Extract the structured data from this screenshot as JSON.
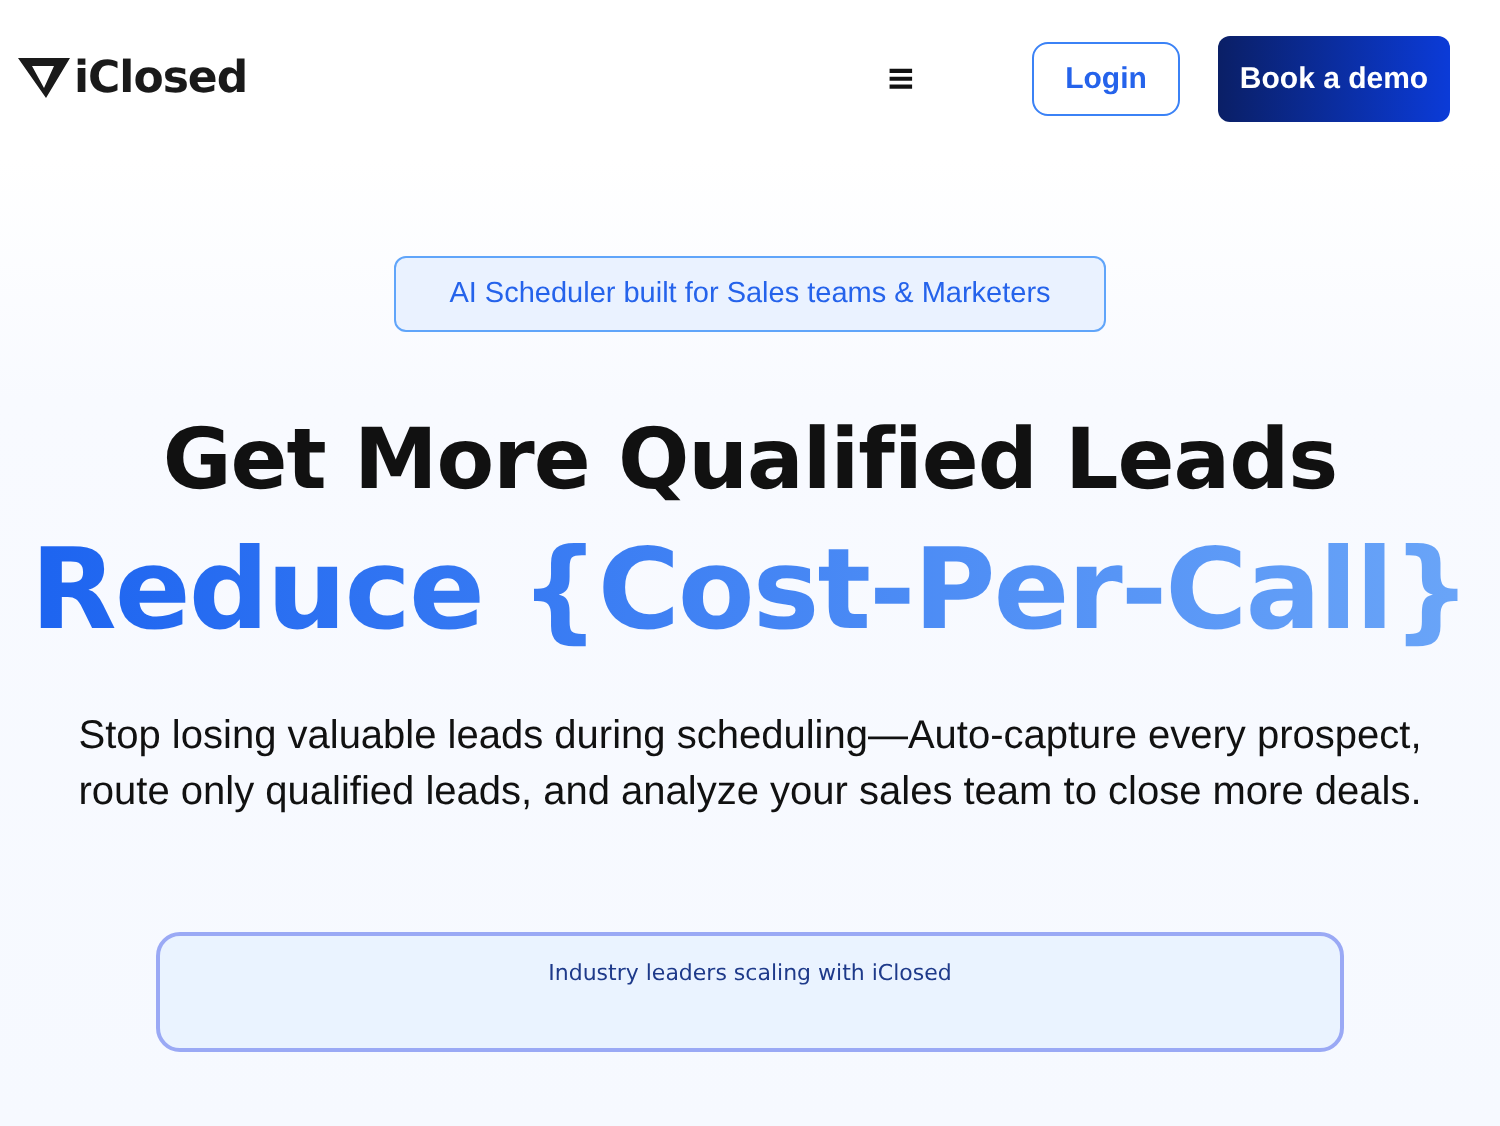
{
  "header": {
    "logo": "iClosed",
    "menu_icon": "≡",
    "login": "Login",
    "cta": "Book a demo"
  },
  "hero": {
    "badge": "AI Scheduler built for Sales teams & Marketers",
    "headline": "Get More Qualified Leads",
    "subheadline": "Reduce {Cost-Per-Call}",
    "description": [
      "Stop losing valuable leads during scheduling—Auto-capture every prospect,",
      "route only qualified leads, and analyze your sales team to close more deals."
    ]
  },
  "card": {
    "title": "Industry leaders scaling with iClosed"
  }
}
